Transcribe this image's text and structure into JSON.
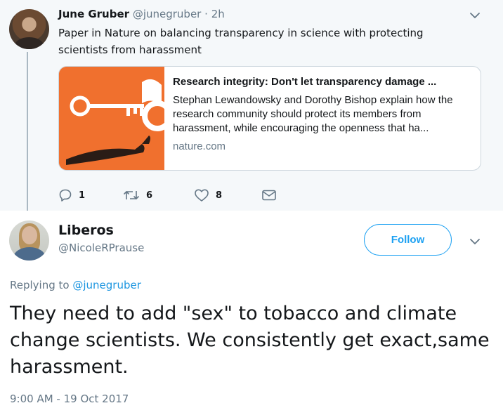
{
  "parent_tweet": {
    "name": "June Gruber",
    "handle": "@junegruber",
    "separator": "·",
    "time": "2h",
    "text": "Paper in Nature on balancing transparency in science with protecting scientists from harassment",
    "card": {
      "title": "Research integrity: Don't let transparency damage ...",
      "description": "Stephan Lewandowsky and Dorothy Bishop explain how the research community should protect its members from harassment, while encouraging the openness that ha...",
      "domain": "nature.com"
    },
    "actions": {
      "replies": "1",
      "retweets": "6",
      "likes": "8"
    },
    "icons": [
      "reply-icon",
      "retweet-icon",
      "heart-icon",
      "envelope-icon",
      "chevron-down-icon"
    ]
  },
  "main_tweet": {
    "name": "Liberos",
    "handle": "@NicoleRPrause",
    "follow_label": "Follow",
    "replying_prefix": "Replying to",
    "replying_to": "@junegruber",
    "text": "They need to add \"sex\" to tobacco and climate change scientists. We consistently get exact,same harassment.",
    "timestamp": "9:00 AM - 19 Oct 2017"
  },
  "colors": {
    "accent": "#1da1f2",
    "muted_text": "#657786",
    "parent_background": "#f5f8fa",
    "card_image_orange": "#f0702e"
  }
}
